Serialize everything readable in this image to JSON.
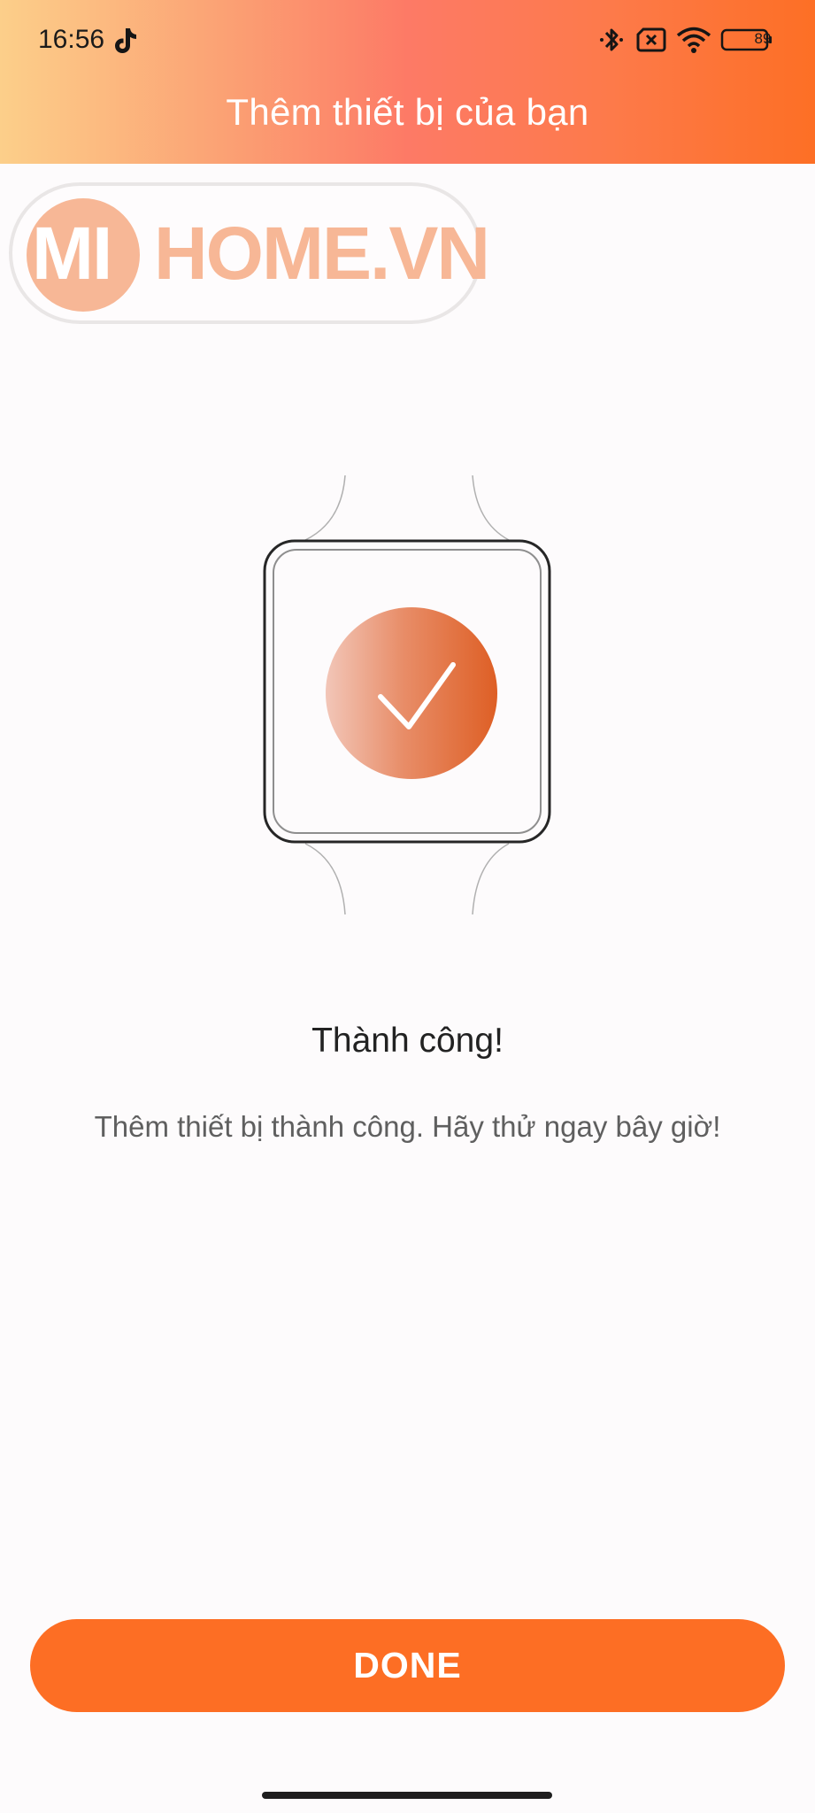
{
  "status_bar": {
    "time": "16:56",
    "battery_level": "89",
    "icons": [
      "tiktok-icon",
      "bluetooth-icon",
      "sim-off-icon",
      "wifi-icon",
      "battery-icon"
    ]
  },
  "header": {
    "title": "Thêm thiết bị của bạn"
  },
  "watermark": {
    "text_mi": "MI",
    "text_home": "HOME.VN"
  },
  "illustration": {
    "icon": "watch-checkmark-icon"
  },
  "result": {
    "title": "Thành công!",
    "message": "Thêm thiết bị thành công. Hãy thử ngay bây giờ!"
  },
  "actions": {
    "done_label": "DONE"
  },
  "colors": {
    "accent": "#fd6e24",
    "header_gradient_start": "#fccf8a",
    "header_gradient_end": "#fd6f25"
  }
}
